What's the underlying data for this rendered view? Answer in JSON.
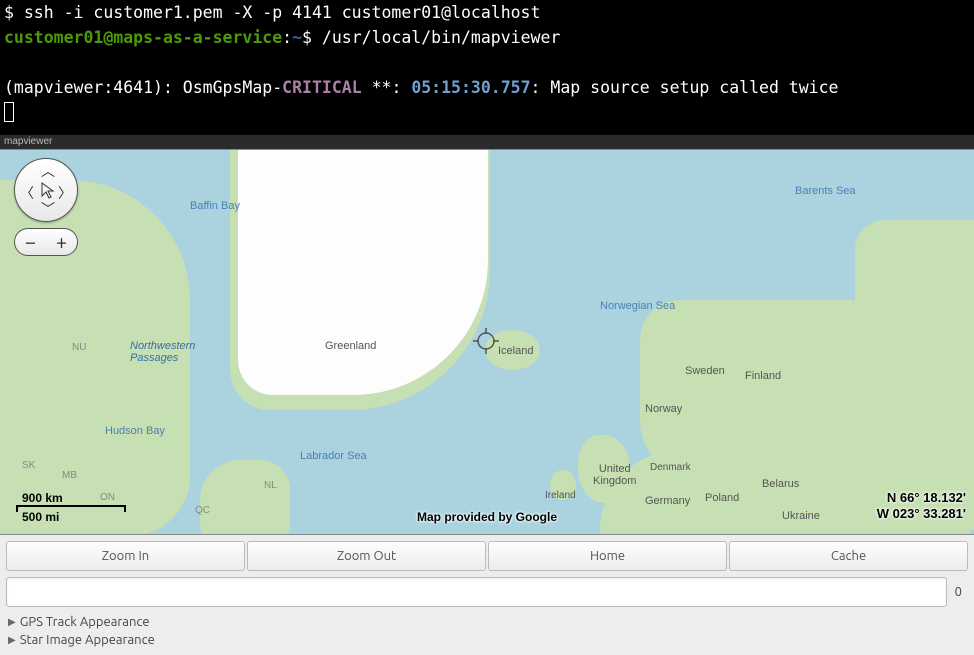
{
  "terminal": {
    "line1": "$ ssh -i customer1.pem -X -p 4141 customer01@localhost",
    "user": "customer01@maps-as-a-service",
    "colon": ":",
    "path": "~",
    "prompt": "$ ",
    "cmd": "/usr/local/bin/mapviewer",
    "log_prefix": "(mapviewer:4641): OsmGpsMap-",
    "log_level": "CRITICAL",
    "log_stars": " **: ",
    "log_time": "05:15:30.757",
    "log_msg": ": Map source setup called twice"
  },
  "window_title": "mapviewer",
  "map": {
    "labels": {
      "baffin_bay": "Baffin Bay",
      "nw_passages": "Northwestern\nPassages",
      "hudson_bay": "Hudson Bay",
      "labrador_sea": "Labrador Sea",
      "greenland": "Greenland",
      "iceland": "Iceland",
      "norwegian_sea": "Norwegian Sea",
      "barents_sea": "Barents Sea",
      "norway": "Norway",
      "sweden": "Sweden",
      "finland": "Finland",
      "denmark": "Denmark",
      "uk": "United\nKingdom",
      "ireland": "Ireland",
      "germany": "Germany",
      "poland": "Poland",
      "belarus": "Belarus",
      "ukraine": "Ukraine",
      "nu": "NU",
      "mb": "MB",
      "on": "ON",
      "qc": "QC",
      "nl": "NL",
      "sk": "SK"
    },
    "scale_km": "900 km",
    "scale_mi": "500 mi",
    "attribution": "Map provided by Google",
    "coords_lat": "N 66° 18.132'",
    "coords_lon": "W 023° 33.281'"
  },
  "buttons": {
    "zoom_in": "Zoom In",
    "zoom_out": "Zoom Out",
    "home": "Home",
    "cache": "Cache"
  },
  "input": {
    "count": "0"
  },
  "expanders": {
    "gps": "GPS Track Appearance",
    "star": "Star Image Appearance"
  }
}
